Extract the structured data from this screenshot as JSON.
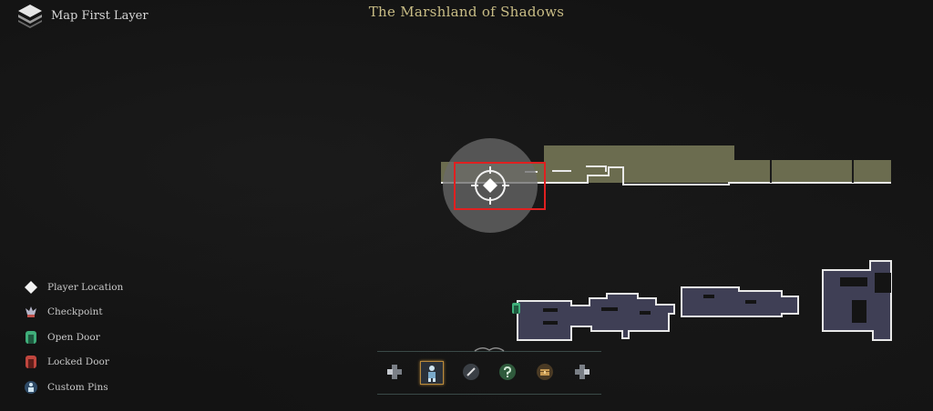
{
  "header": {
    "layer_label": "Map First Layer",
    "region_title": "The Marshland of Shadows"
  },
  "legend": [
    {
      "label": "Player Location",
      "icon": "diamond-icon"
    },
    {
      "label": "Checkpoint",
      "icon": "checkpoint-icon"
    },
    {
      "label": "Open Door",
      "icon": "open-door-icon"
    },
    {
      "label": "Locked Door",
      "icon": "locked-door-icon"
    },
    {
      "label": "Custom Pins",
      "icon": "custom-pin-icon"
    }
  ],
  "toolbar": [
    {
      "icon": "dpad-left-icon"
    },
    {
      "icon": "character-icon",
      "active": true
    },
    {
      "icon": "sword-icon"
    },
    {
      "icon": "question-icon"
    },
    {
      "icon": "chest-icon"
    },
    {
      "icon": "dpad-right-icon"
    }
  ],
  "colors": {
    "explored_area": "#6b6c4f",
    "room_fill": "#3f3f55",
    "room_outline": "#e8e8e8",
    "title": "#c9bd86",
    "highlight_box": "#e02020"
  }
}
